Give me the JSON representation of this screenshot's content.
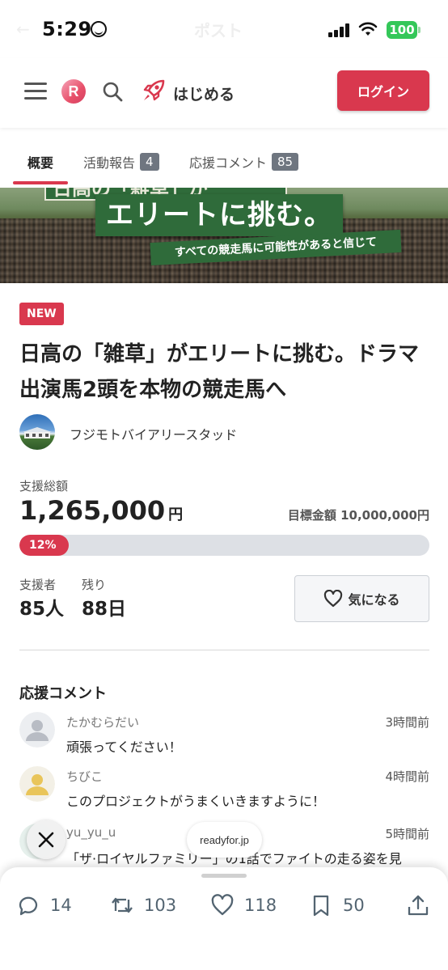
{
  "status_bar": {
    "time": "5:29",
    "battery": "100",
    "ghost_title": "ポスト"
  },
  "header": {
    "start_label": "はじめる",
    "login_label": "ログイン",
    "logo_letter": "R"
  },
  "tabs": [
    {
      "label": "概要"
    },
    {
      "label": "活動報告",
      "count": "4"
    },
    {
      "label": "応援コメント",
      "count": "85"
    }
  ],
  "banner": {
    "top_text": "日高の「雑草」が",
    "main_text": "エリートに挑む。",
    "sub_text": "すべての競走馬に可能性があると信じて"
  },
  "project": {
    "badge": "NEW",
    "title": "日高の「雑草」がエリートに挑む。ドラマ出演馬2頭を本物の競走馬へ",
    "owner": "フジモトバイアリースタッド"
  },
  "funding": {
    "raised_label": "支援総額",
    "raised_amount": "1,265,000",
    "raised_unit": "円",
    "goal_text": "目標金額 10,000,000円",
    "progress_label": "12%",
    "progress_fraction": 0.12,
    "supporters_label": "支援者",
    "supporters_value": "85人",
    "remaining_label": "残り",
    "remaining_value": "88日",
    "favorite_label": "気になる"
  },
  "comments": {
    "title": "応援コメント",
    "items": [
      {
        "user": "たかむらだい",
        "time": "3時間前",
        "text": "頑張ってください！"
      },
      {
        "user": "ちびこ",
        "time": "4時間前",
        "text": "このプロジェクトがうまくいきますように！"
      },
      {
        "user": "yu_yu_u",
        "time": "5時間前",
        "text": "「ザ·ロイヤルファミリー」の1話でファイトの走る姿を見"
      }
    ]
  },
  "overlay": {
    "domain": "readyfor.jp"
  },
  "actions": {
    "replies": "14",
    "reposts": "103",
    "likes": "118",
    "bookmarks": "50"
  },
  "colors": {
    "accent": "#d9384e",
    "badge_gray": "#6f7680",
    "battery": "#34c759",
    "banner_green": "#2f6b3a"
  }
}
